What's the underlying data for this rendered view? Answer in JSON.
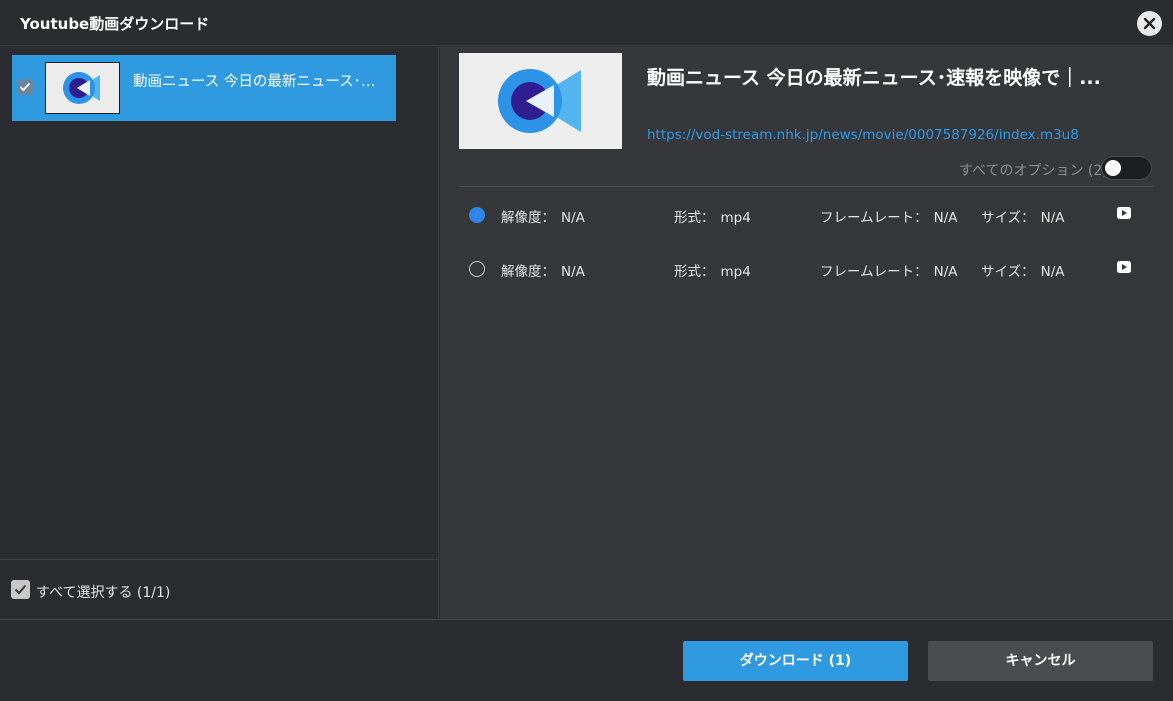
{
  "window": {
    "title": "Youtube動画ダウンロード"
  },
  "list": {
    "items": [
      {
        "title": "動画ニュース 今日の最新ニュース･速報を映像で｜...",
        "checked": true
      }
    ]
  },
  "select_all": {
    "label": "すべて選択する",
    "count": "(1/1)",
    "checked": true
  },
  "detail": {
    "title": "動画ニュース 今日の最新ニュース･速報を映像で｜...",
    "url": "https://vod-stream.nhk.jp/news/movie/0007587926/index.m3u8",
    "options_label": "すべてのオプション",
    "options_count": "(2)",
    "options_toggle_on": false
  },
  "labels": {
    "resolution": "解像度：",
    "format": "形式：",
    "framerate": "フレームレート：",
    "size": "サイズ："
  },
  "options": [
    {
      "resolution": "N/A",
      "format": "mp4",
      "framerate": "N/A",
      "size": "N/A",
      "selected": true
    },
    {
      "resolution": "N/A",
      "format": "mp4",
      "framerate": "N/A",
      "size": "N/A",
      "selected": false
    }
  ],
  "buttons": {
    "download": "ダウンロード (1)",
    "cancel": "キャンセル"
  },
  "icons": {
    "close": "close-icon",
    "check": "check-icon",
    "logo": "video-camera-logo-icon",
    "play": "youtube-play-icon"
  },
  "colors": {
    "accent": "#2f9ae0",
    "link": "#2e9ae6",
    "radio_selected": "#2f86ea",
    "background": "#2b2c30",
    "panel": "#36373b"
  }
}
